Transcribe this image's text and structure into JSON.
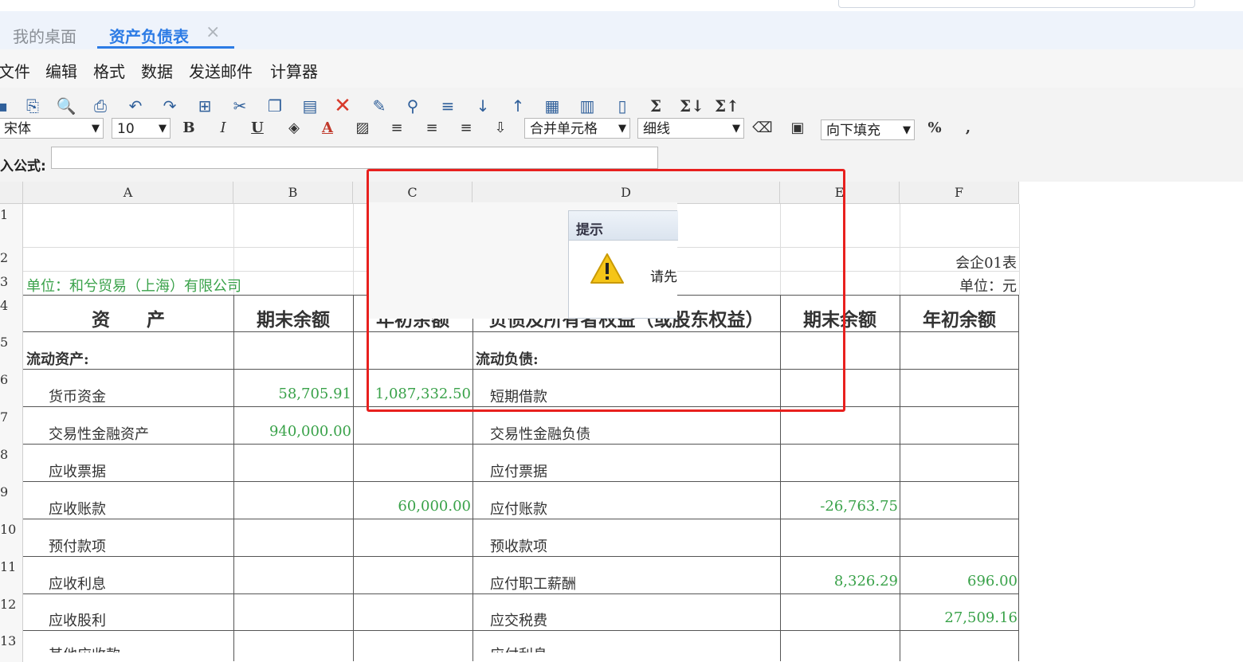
{
  "tabs": {
    "home": "我的桌面",
    "active": "资产负债表",
    "close": "×"
  },
  "menu": {
    "file": "文件",
    "edit": "编辑",
    "format": "格式",
    "data": "数据",
    "send_mail": "发送邮件",
    "calculator": "计算器"
  },
  "toolbar": {
    "font": "宋体",
    "font_size": "10",
    "bold": "B",
    "italic": "I",
    "underline": "U",
    "text_color": "A",
    "merge": "合并单元格",
    "border": "细线",
    "fill": "向下填充",
    "percent": "%",
    "comma": ",",
    "sum1": "Σ",
    "sum2": "Σ↓",
    "sum3": "Σ↑",
    "dropdown_arrow": "▼"
  },
  "formula_bar": {
    "label": "入公式:",
    "value": ""
  },
  "columns": [
    "A",
    "B",
    "C",
    "D",
    "E",
    "F"
  ],
  "rows": [
    "1",
    "2",
    "3",
    "4",
    "5",
    "6",
    "7",
    "8",
    "9",
    "10",
    "11",
    "12",
    "13"
  ],
  "sheet": {
    "form_no": "会企01表",
    "unit_company": "单位：和兮贸易（上海）有限公司",
    "unit_currency": "单位：元",
    "headers": {
      "assets": "资　　产",
      "end_balance": "期末余额",
      "begin_balance": "年初余额",
      "liabilities": "负债及所有者权益（或股东权益）",
      "end_balance2": "期末余额",
      "begin_balance2": "年初余额"
    },
    "current_assets": "流动资产:",
    "current_liabilities": "流动负债:",
    "rows": [
      {
        "a": "货币资金",
        "b": "58,705.91",
        "c": "1,087,332.50",
        "d": "短期借款",
        "e": "",
        "f": ""
      },
      {
        "a": "交易性金融资产",
        "b": "940,000.00",
        "c": "",
        "d": "交易性金融负债",
        "e": "",
        "f": ""
      },
      {
        "a": "应收票据",
        "b": "",
        "c": "",
        "d": "应付票据",
        "e": "",
        "f": ""
      },
      {
        "a": "应收账款",
        "b": "",
        "c": "60,000.00",
        "d": "应付账款",
        "e": "-26,763.75",
        "f": ""
      },
      {
        "a": "预付款项",
        "b": "",
        "c": "",
        "d": "预收款项",
        "e": "",
        "f": ""
      },
      {
        "a": "应收利息",
        "b": "",
        "c": "",
        "d": "应付职工薪酬",
        "e": "8,326.29",
        "f": "696.00"
      },
      {
        "a": "应收股利",
        "b": "",
        "c": "",
        "d": "应交税费",
        "e": "",
        "f": "27,509.16"
      },
      {
        "a": "其他应收款",
        "b": "",
        "c": "",
        "d": "应付利息",
        "e": "",
        "f": ""
      }
    ]
  },
  "dialog": {
    "title": "提示",
    "message": "请先",
    "icon": "warning-icon"
  },
  "colors": {
    "accent": "#2c7be5",
    "green_value": "#3aa24a",
    "highlight": "#e8201e"
  }
}
